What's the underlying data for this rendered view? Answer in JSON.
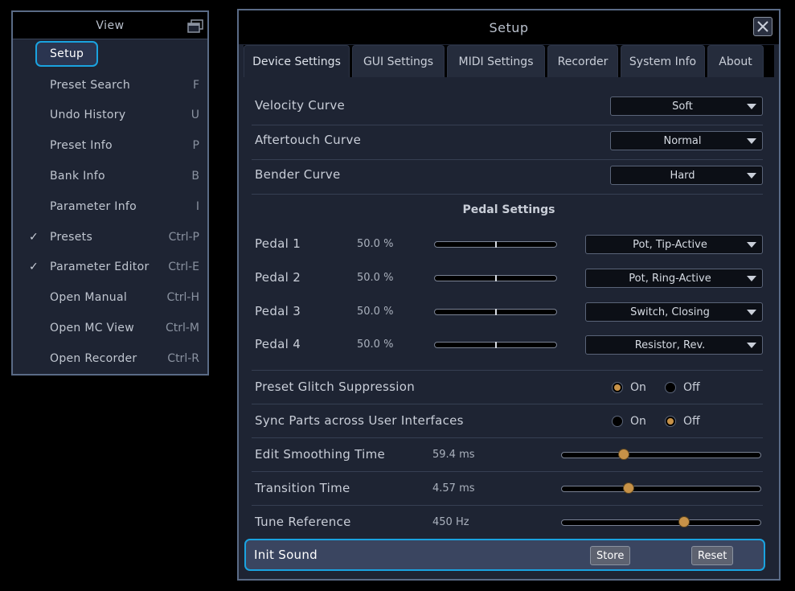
{
  "view_menu": {
    "title": "View",
    "items": [
      {
        "label": "Setup",
        "shortcut": "",
        "checked": false,
        "selected": true
      },
      {
        "label": "Preset Search",
        "shortcut": "F",
        "checked": false
      },
      {
        "label": "Undo History",
        "shortcut": "U",
        "checked": false
      },
      {
        "label": "Preset Info",
        "shortcut": "P",
        "checked": false
      },
      {
        "label": "Bank Info",
        "shortcut": "B",
        "checked": false
      },
      {
        "label": "Parameter Info",
        "shortcut": "I",
        "checked": false
      },
      {
        "label": "Presets",
        "shortcut": "Ctrl-P",
        "checked": true
      },
      {
        "label": "Parameter Editor",
        "shortcut": "Ctrl-E",
        "checked": true
      },
      {
        "label": "Open Manual",
        "shortcut": "Ctrl-H",
        "checked": false
      },
      {
        "label": "Open MC View",
        "shortcut": "Ctrl-M",
        "checked": false
      },
      {
        "label": "Open Recorder",
        "shortcut": "Ctrl-R",
        "checked": false
      }
    ],
    "check_glyph": "✓"
  },
  "setup": {
    "title": "Setup",
    "tabs": [
      "Device Settings",
      "GUI Settings",
      "MIDI Settings",
      "Recorder",
      "System Info",
      "About"
    ],
    "active_tab": "Device Settings",
    "curves": [
      {
        "label": "Velocity Curve",
        "value": "Soft"
      },
      {
        "label": "Aftertouch Curve",
        "value": "Normal"
      },
      {
        "label": "Bender Curve",
        "value": "Hard"
      }
    ],
    "pedal_section_title": "Pedal Settings",
    "pedals": [
      {
        "label": "Pedal 1",
        "percent": "50.0 %",
        "level": 0.5,
        "type": "Pot, Tip-Active"
      },
      {
        "label": "Pedal 2",
        "percent": "50.0 %",
        "level": 0.5,
        "type": "Pot, Ring-Active"
      },
      {
        "label": "Pedal 3",
        "percent": "50.0 %",
        "level": 0.5,
        "type": "Switch, Closing"
      },
      {
        "label": "Pedal 4",
        "percent": "50.0 %",
        "level": 0.5,
        "type": "Resistor, Rev."
      }
    ],
    "glitch": {
      "label": "Preset Glitch Suppression",
      "on_label": "On",
      "off_label": "Off",
      "value": "On"
    },
    "sync": {
      "label": "Sync Parts across User Interfaces",
      "on_label": "On",
      "off_label": "Off",
      "value": "Off"
    },
    "sliders": [
      {
        "label": "Edit Smoothing Time",
        "value": "59.4 ms",
        "fraction": 0.31
      },
      {
        "label": "Transition Time",
        "value": "4.57 ms",
        "fraction": 0.335
      },
      {
        "label": "Tune Reference",
        "value": "450 Hz",
        "fraction": 0.615
      }
    ],
    "init_sound": {
      "label": "Init Sound",
      "store_label": "Store",
      "reset_label": "Reset"
    },
    "accent_color": "#1aa3e0",
    "knob_color": "#c79248"
  }
}
